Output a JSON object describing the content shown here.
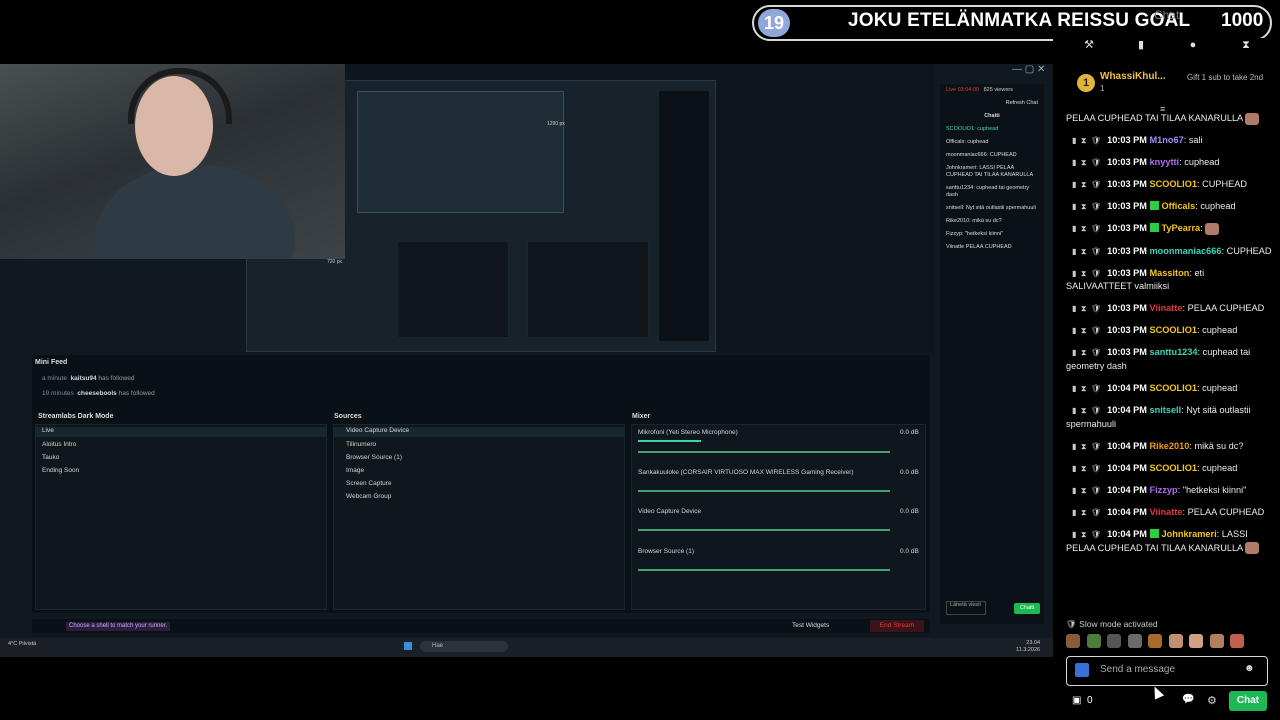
{
  "goal": {
    "count": "19",
    "title": "JOKU ETELÄNMATKA REISSU GOAL",
    "target": "1000",
    "overlap_label": "Chat"
  },
  "pinned": {
    "badge": "1",
    "user": "WhassiKhul...",
    "count": "1",
    "gift_text": "Gift 1 sub to take 2nd"
  },
  "messages": [
    {
      "time": "",
      "user": "",
      "user_color": "",
      "text": "PELAA CUPHEAD TAI TILAA KANARULLA",
      "emote": true,
      "continuation": true
    },
    {
      "time": "10:03 PM",
      "user": "M1no67",
      "user_color": "#a78bfa",
      "text": "sali"
    },
    {
      "time": "10:03 PM",
      "user": "knyytti",
      "user_color": "#b06cf0",
      "text": "cuphead"
    },
    {
      "time": "10:03 PM",
      "user": "SCOOLIO1",
      "user_color": "#f5c518",
      "text": "CUPHEAD"
    },
    {
      "time": "10:03 PM",
      "user": "Officals",
      "user_color": "#f5c518",
      "text": "cuphead",
      "badge": "green"
    },
    {
      "time": "10:03 PM",
      "user": "TyPearra",
      "user_color": "#f5c518",
      "text": "",
      "badge": "green",
      "emote": true
    },
    {
      "time": "10:03 PM",
      "user": "moonmaniac666",
      "user_color": "#3ad6c0",
      "text": "CUPHEAD"
    },
    {
      "time": "10:03 PM",
      "user": "Massiton",
      "user_color": "#f5c518",
      "text": "eti SALIVAATTEET valmiiksi"
    },
    {
      "time": "10:03 PM",
      "user": "Viinatte",
      "user_color": "#e53935",
      "text": "PELAA CUPHEAD"
    },
    {
      "time": "10:03 PM",
      "user": "SCOOLIO1",
      "user_color": "#f5c518",
      "text": "cuphead"
    },
    {
      "time": "10:03 PM",
      "user": "santtu1234",
      "user_color": "#3ad6c0",
      "text": "cuphead tai geometry dash"
    },
    {
      "time": "10:04 PM",
      "user": "SCOOLIO1",
      "user_color": "#f5c518",
      "text": "cuphead"
    },
    {
      "time": "10:04 PM",
      "user": "snitsell",
      "user_color": "#3ad6c0",
      "text": "Nyt sitä outlastii spermahuuli"
    },
    {
      "time": "10:04 PM",
      "user": "Rike2010",
      "user_color": "#f59e0b",
      "text": "mikä su dc?"
    },
    {
      "time": "10:04 PM",
      "user": "SCOOLIO1",
      "user_color": "#f5c518",
      "text": "cuphead"
    },
    {
      "time": "10:04 PM",
      "user": "Fizzyp",
      "user_color": "#b06cf0",
      "text": "\"hetkeksi kiinni\""
    },
    {
      "time": "10:04 PM",
      "user": "Viinatte",
      "user_color": "#e53935",
      "text": "PELAA CUPHEAD"
    },
    {
      "time": "10:04 PM",
      "user": "Johnkrameri",
      "user_color": "#f5c518",
      "text": "LASSI PELAA CUPHEAD TAI TILAA KANARULLA",
      "badge": "green",
      "emote": true
    }
  ],
  "chat_footer": {
    "slow_mode": "Slow mode activated",
    "send_placeholder": "Send a message",
    "points": "0",
    "chat_button": "Chat"
  },
  "obs": {
    "live_time": "Live 03:04:00",
    "viewers": "825 viewers",
    "refresh_chat": "Refresh Chat",
    "chat_title": "Chatti",
    "mini_feed_title": "Mini Feed",
    "feed": [
      {
        "time": "a minute",
        "user": "kaitsu94",
        "action": "has followed"
      },
      {
        "time": "19 minutes",
        "user": "cheesebools",
        "action": "has followed"
      }
    ],
    "scenes_title": "Streamlabs Dark Mode",
    "scenes": [
      "Live",
      "Aloitus Intro",
      "Tauko",
      "Ending Soon"
    ],
    "sources_title": "Sources",
    "sources": [
      "Video Capture Device",
      "Tilinumero",
      "Browser Source (1)",
      "Image",
      "Screen Capture",
      "Webcam Group"
    ],
    "mixer_title": "Mixer",
    "mixer": [
      {
        "name": "Mikrofoni (Yeti Stereo Microphone)",
        "db": "0.0 dB",
        "level": 0.25
      },
      {
        "name": "Sankakuuloke (CORSAIR VIRTUOSO MAX WIRELESS Gaming Receiver)",
        "db": "0.0 dB",
        "level": 0
      },
      {
        "name": "Video Capture Device",
        "db": "0.0 dB",
        "level": 0
      },
      {
        "name": "Browser Source (1)",
        "db": "0.0 dB",
        "level": 0
      }
    ],
    "status_hint": "Choose a shell to match your runner.",
    "test_widgets": "Test Widgets",
    "end_stream": "End Stream",
    "chat_send": "Chatti",
    "chat_input": "Lähetä viesti",
    "preview_value": "1290 px",
    "preview_value2": "720 px"
  },
  "taskbar": {
    "weather": "4°C Pilvistä",
    "search": "Hae",
    "clock_time": "23.04",
    "clock_date": "11.3.2026"
  },
  "colors": {
    "accent": "#1db954",
    "goal_badge": "#8fa8d9",
    "end_stream": "#e53935"
  }
}
